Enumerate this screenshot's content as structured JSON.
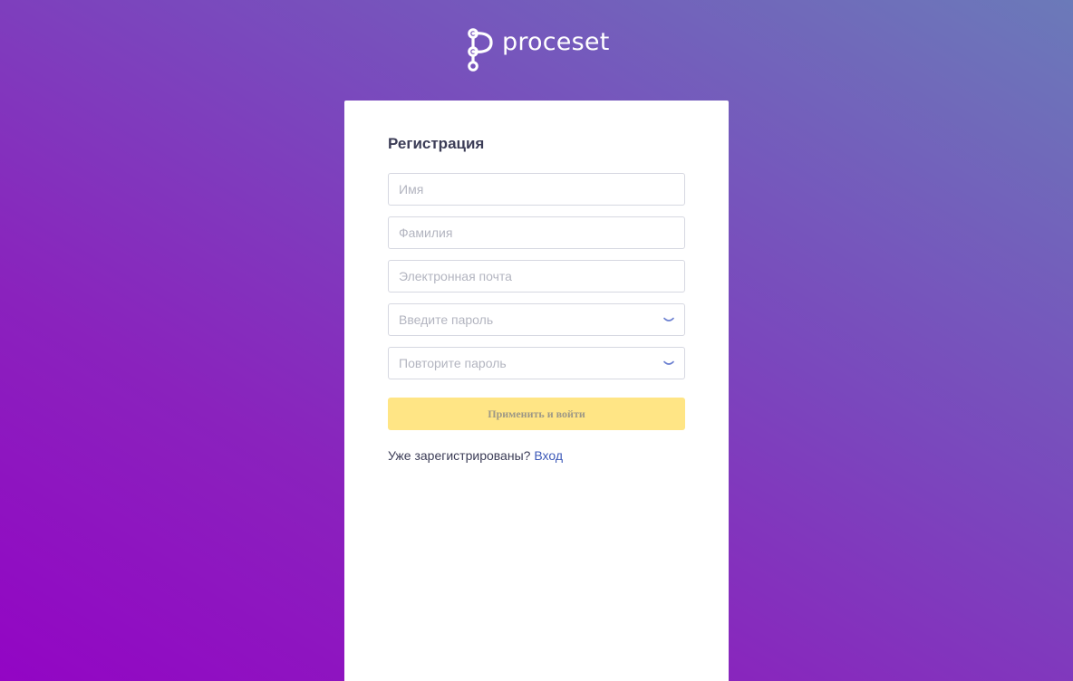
{
  "brand": {
    "name": "proceset",
    "logo_icon": "proceset-logo-icon"
  },
  "form": {
    "title": "Регистрация",
    "fields": [
      {
        "placeholder": "Имя",
        "value": ""
      },
      {
        "placeholder": "Фамилия",
        "value": ""
      },
      {
        "placeholder": "Электронная почта",
        "value": ""
      },
      {
        "placeholder": "Введите пароль",
        "value": "",
        "icon": "eye-closed-icon"
      },
      {
        "placeholder": "Повторите пароль",
        "value": "",
        "icon": "eye-closed-icon"
      }
    ],
    "submit_label": "Применить и войти",
    "login_prompt": "Уже зарегистрированы?",
    "login_link": "Вход"
  },
  "colors": {
    "background_start": "#9305c4",
    "background_end": "#6b7ab9",
    "submit_bg": "#ffe585",
    "link": "#3e5ab8",
    "title": "#3c3d57"
  }
}
